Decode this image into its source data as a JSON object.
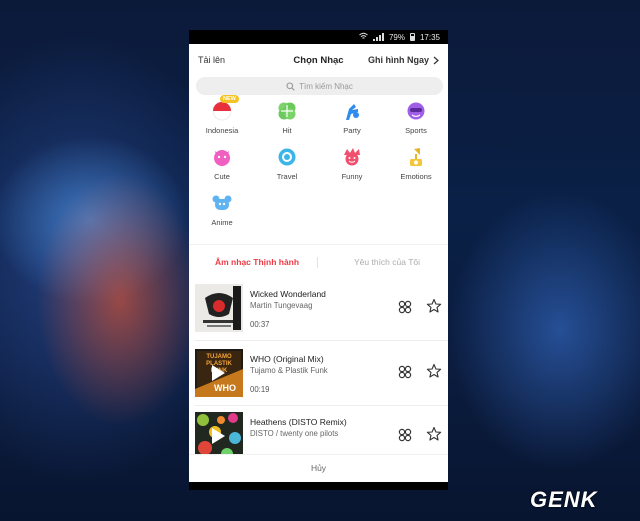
{
  "status": {
    "battery": "79%",
    "time": "17:35"
  },
  "header": {
    "left": "Tải lên",
    "title": "Chọn Nhạc",
    "right": "Ghi hình Ngay"
  },
  "search": {
    "placeholder": "Tìm kiếm Nhạc"
  },
  "categories": [
    {
      "label": "Indonesia",
      "badge": "NEW",
      "icon": "indonesia-flag-icon"
    },
    {
      "label": "Hit",
      "icon": "hit-icon"
    },
    {
      "label": "Party",
      "icon": "party-icon"
    },
    {
      "label": "Sports",
      "icon": "sports-icon"
    },
    {
      "label": "Cute",
      "icon": "cute-icon"
    },
    {
      "label": "Travel",
      "icon": "travel-icon"
    },
    {
      "label": "Funny",
      "icon": "funny-icon"
    },
    {
      "label": "Emotions",
      "icon": "emotions-icon"
    },
    {
      "label": "Anime",
      "icon": "anime-icon"
    }
  ],
  "tabs": {
    "active": "Âm nhạc Thịnh hành",
    "inactive": "Yêu thích của Tôi"
  },
  "tracks": [
    {
      "title": "Wicked Wonderland",
      "artist": "Martin Tungevaag",
      "duration": "00:37"
    },
    {
      "title": "WHO (Original Mix)",
      "artist": "Tujamo & Plastik Funk",
      "duration": "00:19",
      "cover_text": "TUJAMO PLASTIK FUNK WHO"
    },
    {
      "title": "Heathens (DISTO Remix)",
      "artist": "DISTO / twenty one pilots",
      "duration": ""
    }
  ],
  "footer": {
    "cancel": "Hủy"
  },
  "watermark": "GENK",
  "colors": {
    "accent": "#ee3a45",
    "search_bg": "#eeeeee"
  }
}
